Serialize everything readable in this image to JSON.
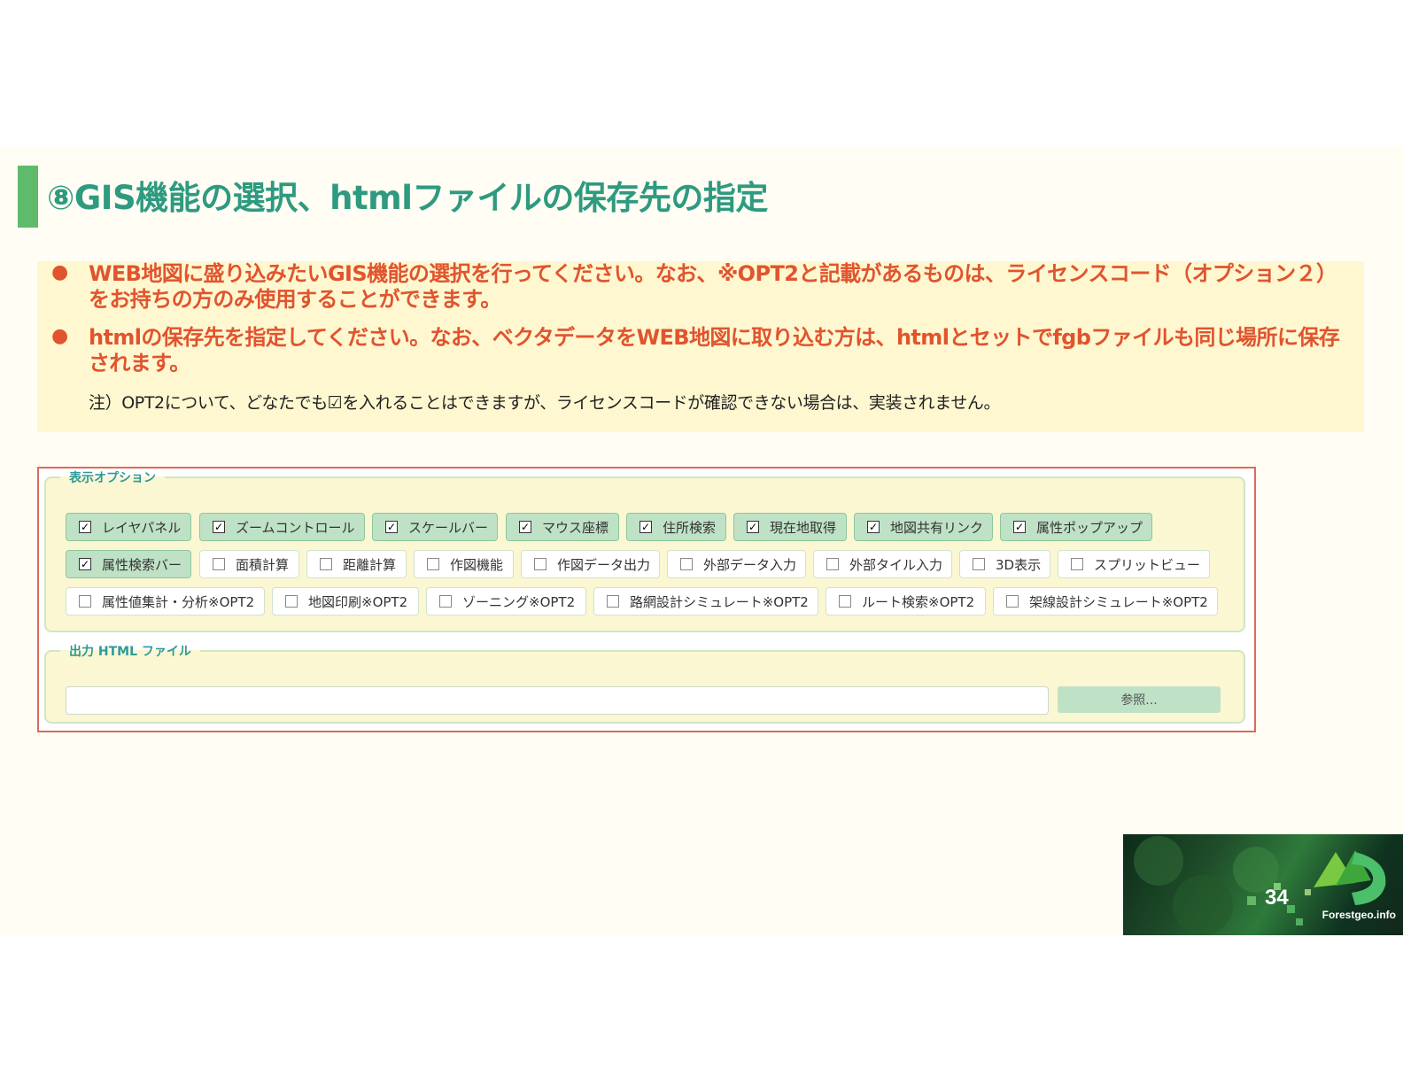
{
  "title": "⑧GIS機能の選択、htmlファイルの保存先の指定",
  "bullets": [
    "WEB地図に盛り込みたいGIS機能の選択を行ってください。なお、※OPT2と記載があるものは、ライセンスコード（オプション２）をお持ちの方のみ使用することができます。",
    "htmlの保存先を指定してください。なお、ベクタデータをWEB地図に取り込む方は、htmlとセットでfgbファイルも同じ場所に保存されます。"
  ],
  "note": "注）OPT2について、どなたでも☑を入れることはできますが、ライセンスコードが確認できない場合は、実装されません。",
  "display_options": {
    "legend": "表示オプション",
    "items": [
      {
        "label": "レイヤパネル",
        "checked": true
      },
      {
        "label": "ズームコントロール",
        "checked": true
      },
      {
        "label": "スケールバー",
        "checked": true
      },
      {
        "label": "マウス座標",
        "checked": true
      },
      {
        "label": "住所検索",
        "checked": true
      },
      {
        "label": "現在地取得",
        "checked": true
      },
      {
        "label": "地図共有リンク",
        "checked": true
      },
      {
        "label": "属性ポップアップ",
        "checked": true
      },
      {
        "label": "属性検索バー",
        "checked": true
      },
      {
        "label": "面積計算",
        "checked": false
      },
      {
        "label": "距離計算",
        "checked": false
      },
      {
        "label": "作図機能",
        "checked": false
      },
      {
        "label": "作図データ出力",
        "checked": false
      },
      {
        "label": "外部データ入力",
        "checked": false
      },
      {
        "label": "外部タイル入力",
        "checked": false
      },
      {
        "label": "3D表示",
        "checked": false
      },
      {
        "label": "スプリットビュー",
        "checked": false
      },
      {
        "label": "属性値集計・分析※OPT2",
        "checked": false
      },
      {
        "label": "地図印刷※OPT2",
        "checked": false
      },
      {
        "label": "ゾーニング※OPT2",
        "checked": false
      },
      {
        "label": "路網設計シミュレート※OPT2",
        "checked": false
      },
      {
        "label": "ルート検索※OPT2",
        "checked": false
      },
      {
        "label": "架線設計シミュレート※OPT2",
        "checked": false
      }
    ]
  },
  "output_html": {
    "legend": "出力 HTML ファイル",
    "value": "",
    "browse_label": "参照..."
  },
  "footer": {
    "page_number": "34",
    "brand": "Forestgeo.info"
  },
  "colors": {
    "title": "#2e9a7f",
    "accent_bar": "#5fbb6b",
    "bullet_text": "#e0542e",
    "note_bg": "#fef7d0",
    "checked_bg": "#bfe2c6"
  }
}
